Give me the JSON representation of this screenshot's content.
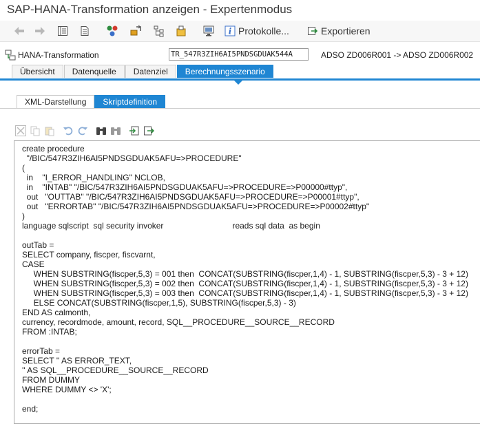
{
  "window": {
    "title": "SAP-HANA-Transformation   anzeigen - Expertenmodus"
  },
  "toolbar": {
    "protokolle_label": "Protokolle...",
    "exportieren_label": "Exportieren"
  },
  "header": {
    "label": "HANA-Transformation",
    "transformation_id": "TR_547R3ZIH6AI5PNDSGDUAK544A",
    "description": "ADSO ZD006R001 -> ADSO ZD006R002"
  },
  "main_tabs": [
    {
      "label": "Übersicht"
    },
    {
      "label": "Datenquelle"
    },
    {
      "label": "Datenziel"
    },
    {
      "label": "Berechnungsszenario"
    }
  ],
  "sub_tabs": [
    {
      "label": "XML-Darstellung"
    },
    {
      "label": "Skriptdefinition"
    }
  ],
  "editor": {
    "code": "create procedure\n  \"/BIC/547R3ZIH6AI5PNDSGDUAK5AFU=>PROCEDURE\"\n(\n  in    \"I_ERROR_HANDLING\" NCLOB,\n  in    \"INTAB\" \"/BIC/547R3ZIH6AI5PNDSGDUAK5AFU=>PROCEDURE=>P00000#ttyp\",\n  out   \"OUTTAB\" \"/BIC/547R3ZIH6AI5PNDSGDUAK5AFU=>PROCEDURE=>P00001#ttyp\",\n  out   \"ERRORTAB\" \"/BIC/547R3ZIH6AI5PNDSGDUAK5AFU=>PROCEDURE=>P00002#ttyp\"\n)\nlanguage sqlscript  sql security invoker                              reads sql data  as begin\n\noutTab =\nSELECT company, fiscper, fiscvarnt,\nCASE\n     WHEN SUBSTRING(fiscper,5,3) = 001 then  CONCAT(SUBSTRING(fiscper,1,4) - 1, SUBSTRING(fiscper,5,3) - 3 + 12)\n     WHEN SUBSTRING(fiscper,5,3) = 002 then  CONCAT(SUBSTRING(fiscper,1,4) - 1, SUBSTRING(fiscper,5,3) - 3 + 12)\n     WHEN SUBSTRING(fiscper,5,3) = 003 then  CONCAT(SUBSTRING(fiscper,1,4) - 1, SUBSTRING(fiscper,5,3) - 3 + 12)\n     ELSE CONCAT(SUBSTRING(fiscper,1,5), SUBSTRING(fiscper,5,3) - 3)\nEND AS calmonth,\ncurrency, recordmode, amount, record, SQL__PROCEDURE__SOURCE__RECORD\nFROM :INTAB;\n\nerrorTab =\nSELECT '' AS ERROR_TEXT,\n'' AS SQL__PROCEDURE__SOURCE__RECORD\nFROM DUMMY\nWHERE DUMMY <> 'X';\n\nend;"
  }
}
